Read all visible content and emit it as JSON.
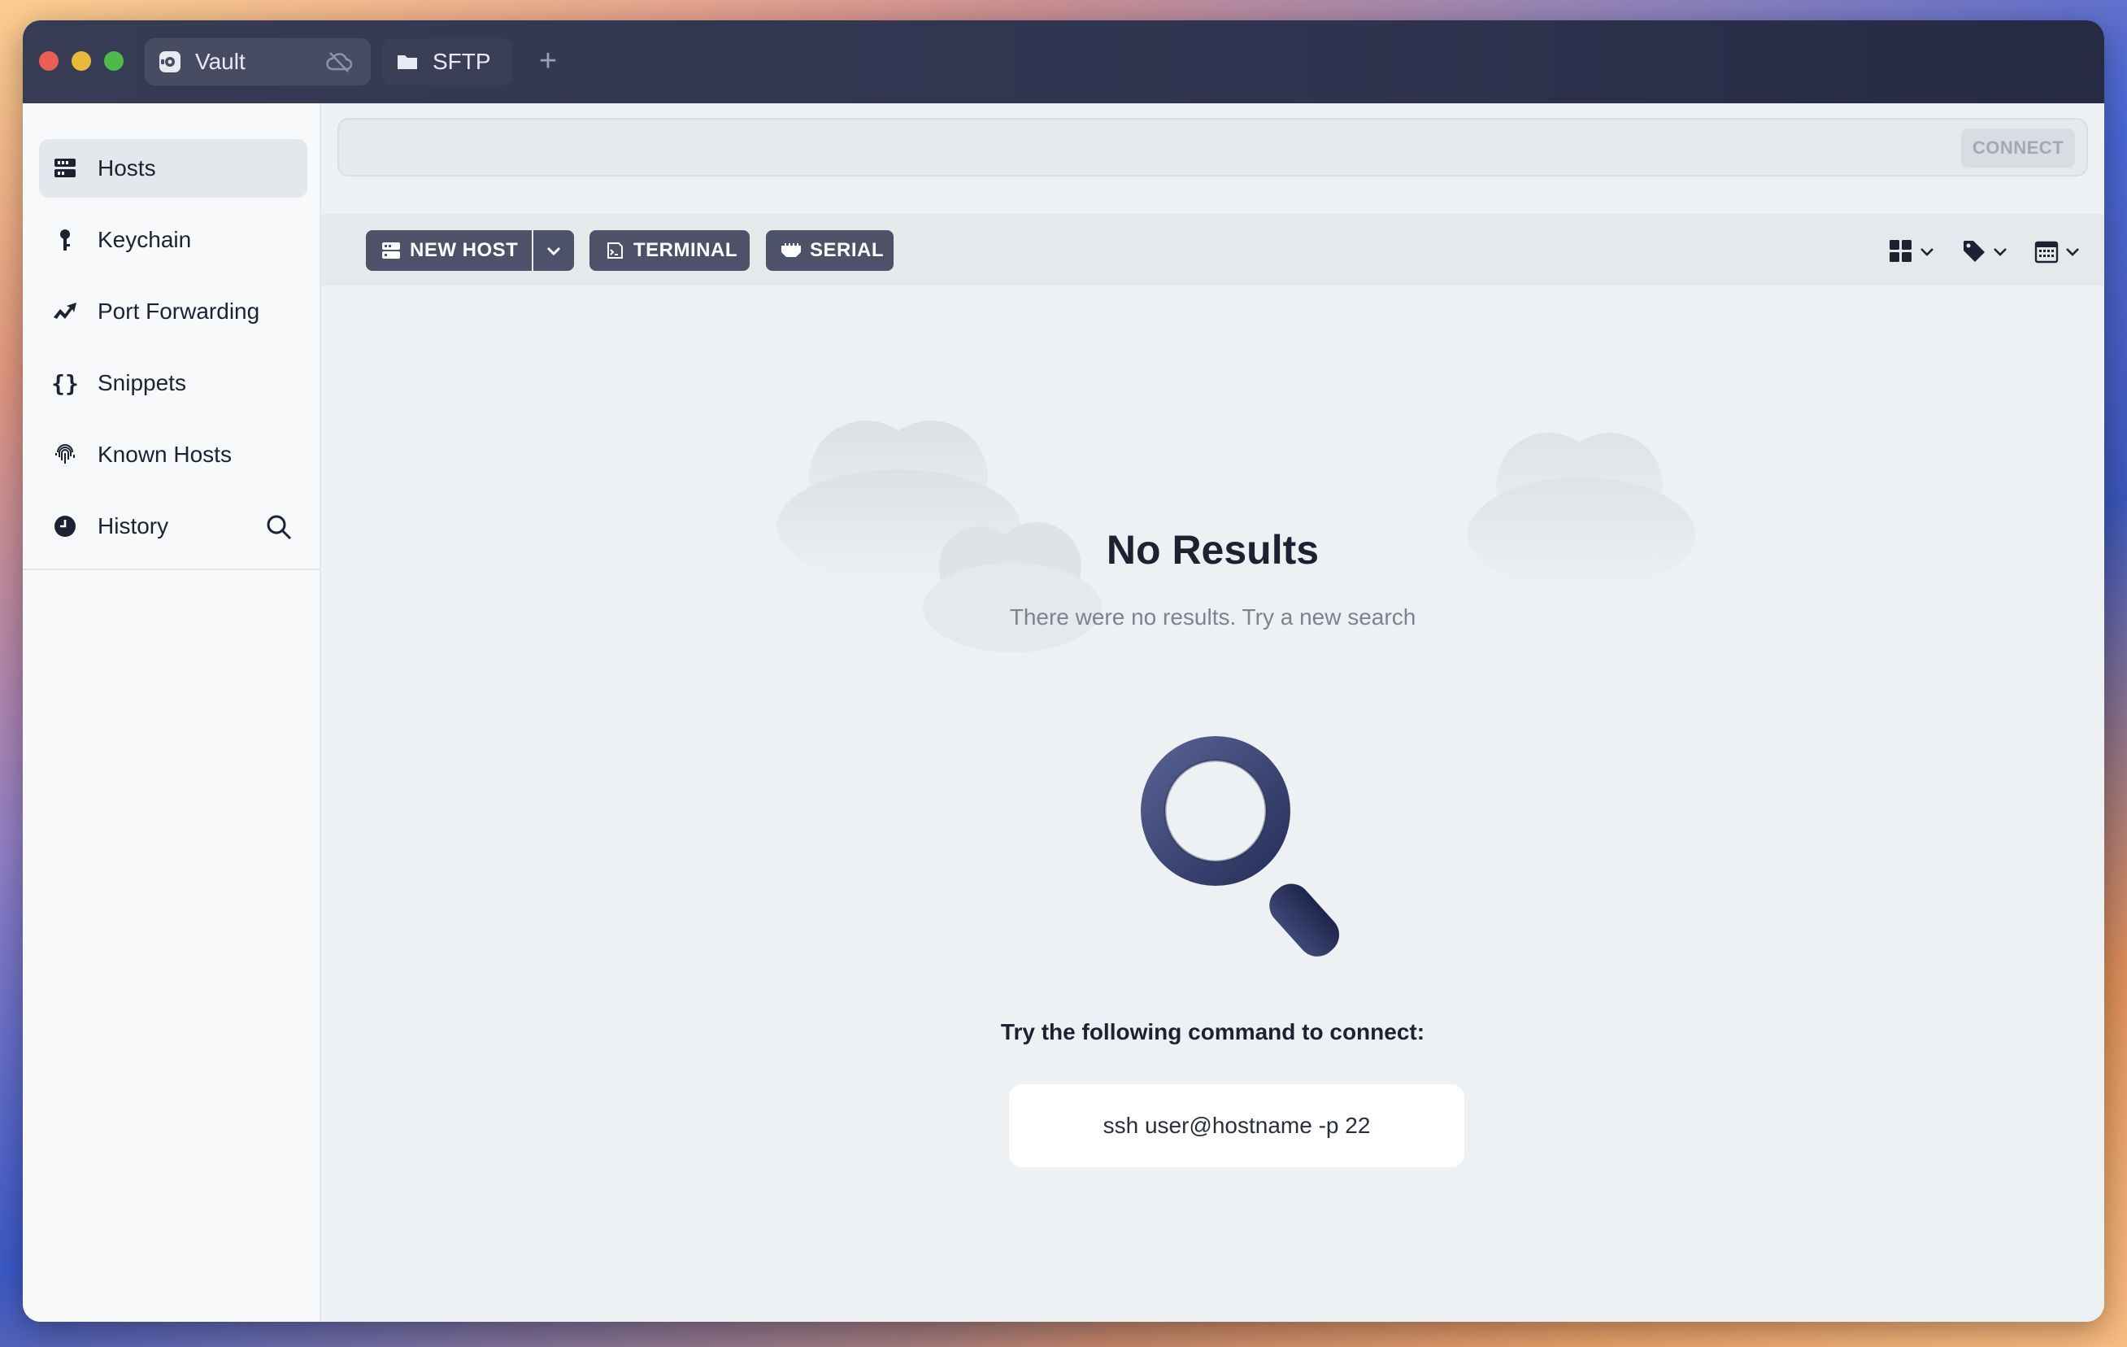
{
  "tabs": [
    {
      "label": "Vault",
      "icon": "vault-icon",
      "status_icon": "cloud-off-icon"
    },
    {
      "label": "SFTP",
      "icon": "folder-icon"
    }
  ],
  "add_tab_icon": "plus-icon",
  "sidebar": {
    "items": [
      {
        "label": "Hosts",
        "icon": "hosts-icon",
        "active": true
      },
      {
        "label": "Keychain",
        "icon": "key-icon"
      },
      {
        "label": "Port Forwarding",
        "icon": "port-forwarding-icon"
      },
      {
        "label": "Snippets",
        "icon": "braces-icon"
      },
      {
        "label": "Known Hosts",
        "icon": "fingerprint-icon"
      },
      {
        "label": "History",
        "icon": "clock-icon",
        "action_icon": "search-icon"
      }
    ]
  },
  "searchbar": {
    "placeholder": "",
    "connect_label": "CONNECT"
  },
  "toolbar": {
    "new_host_label": "NEW HOST",
    "terminal_label": "TERMINAL",
    "serial_label": "SERIAL",
    "view_controls": [
      "grid-view-icon",
      "tag-icon",
      "calendar-icon"
    ]
  },
  "empty_state": {
    "title": "No Results",
    "subtitle": "There were no results. Try a new search",
    "hint": "Try the following command to connect:",
    "command": "ssh user@hostname -p 22"
  },
  "colors": {
    "titlebar": "#2f3450",
    "button": "#4d5268",
    "accent_magnifier": "#3a4370"
  }
}
